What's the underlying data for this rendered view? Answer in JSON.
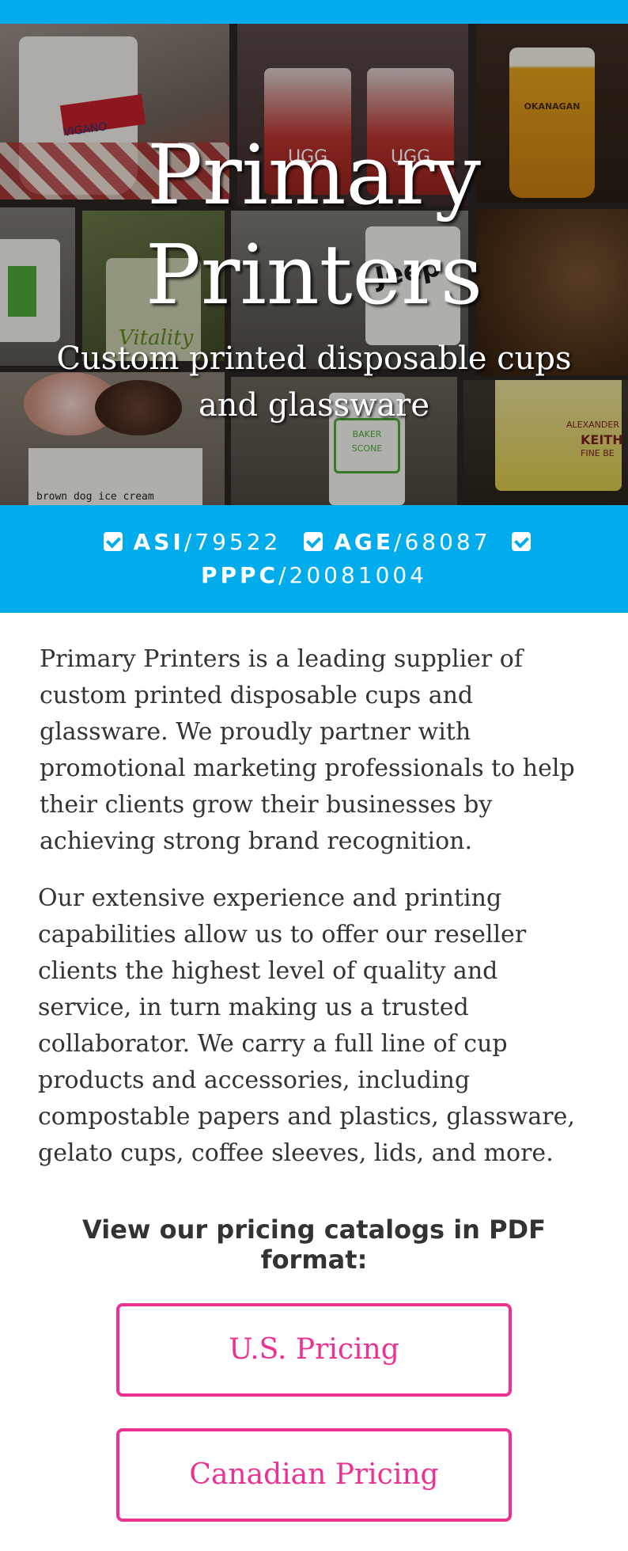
{
  "hero": {
    "title_line1": "Primary",
    "title_line2": "Printers",
    "subtitle": "Custom printed disposable cups and glassware",
    "photo_labels": [
      "VIGANO",
      "UGG",
      "UGG",
      "OKANAGAN",
      "Vitality",
      "Jeep",
      "BAKER",
      "SCONE",
      "ALEXANDER",
      "KEITH",
      "FINE BE",
      "brown dog ice cream"
    ]
  },
  "certifications": [
    {
      "name": "ASI",
      "number": "79522"
    },
    {
      "name": "AGE",
      "number": "68087"
    },
    {
      "name": "PPPC",
      "number": "20081004"
    }
  ],
  "intro": {
    "paragraph1": "Primary Printers is a leading supplier of custom printed disposable cups and glassware. We proudly partner with promotional marketing professionals to help their clients grow their businesses by achieving strong brand recognition.",
    "paragraph2": "Our extensive experience and printing capabilities allow us to offer our reseller clients the highest level of quality and service, in turn making us a trusted collaborator. We carry a full line of cup products and accessories, including compostable papers and plastics, glassware, gelato cups, coffee sleeves, lids, and more."
  },
  "catalogs": {
    "heading": "View our pricing catalogs in PDF format:",
    "us_label": "U.S. Pricing",
    "canadian_label": "Canadian Pricing"
  },
  "colors": {
    "brand_blue": "#00acec",
    "accent_pink": "#ec3193",
    "body_text": "#333333"
  },
  "icons": [
    "checkbox-icon"
  ]
}
